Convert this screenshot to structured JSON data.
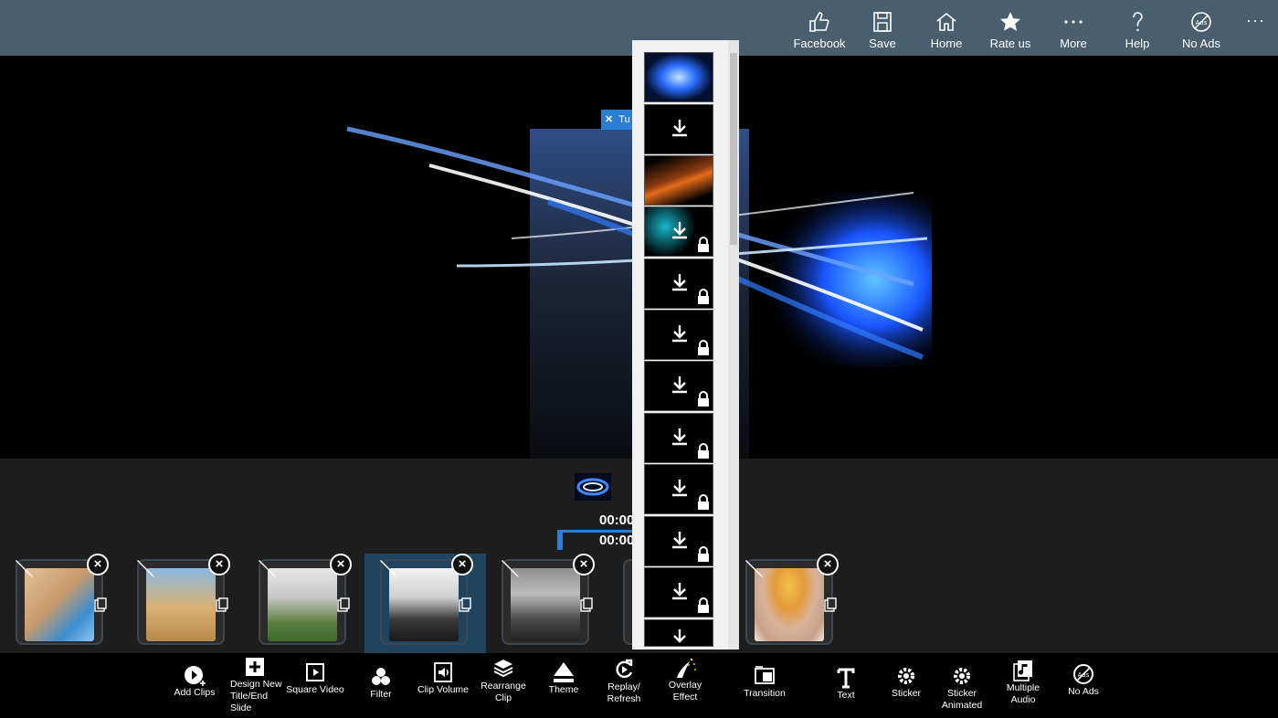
{
  "topbar": {
    "items": [
      {
        "label": "Facebook",
        "icon": "thumbs-up-icon"
      },
      {
        "label": "Save",
        "icon": "save-icon"
      },
      {
        "label": "Home",
        "icon": "home-icon"
      },
      {
        "label": "Rate us",
        "icon": "star-icon"
      },
      {
        "label": "More",
        "icon": "more-icon"
      },
      {
        "label": "Help",
        "icon": "help-icon"
      },
      {
        "label": "No Ads",
        "icon": "no-ads-icon"
      }
    ],
    "overflow": "···"
  },
  "preview": {
    "tag_text": "Tu",
    "tag_close": "✕"
  },
  "timeline": {
    "time1": "00:00",
    "time2": "00:00"
  },
  "clips": [
    {
      "name": "clip-1",
      "colors": [
        "#d7b690",
        "#4d8ec9"
      ]
    },
    {
      "name": "clip-2",
      "colors": [
        "#d9b070",
        "#7aaed6"
      ]
    },
    {
      "name": "clip-3",
      "colors": [
        "#cfcfcf",
        "#3c6b2b"
      ]
    },
    {
      "name": "clip-4",
      "colors": [
        "#ededed",
        "#222222"
      ]
    },
    {
      "name": "clip-5",
      "colors": [
        "#9a9a9a",
        "#2a2a2a"
      ]
    },
    {
      "name": "clip-7",
      "colors": [
        "#e8b34a",
        "#c7a089"
      ]
    }
  ],
  "overlay_panel": {
    "items": [
      {
        "type": "preview",
        "locked": false
      },
      {
        "type": "download",
        "locked": false
      },
      {
        "type": "orange",
        "locked": false
      },
      {
        "type": "download",
        "locked": true
      },
      {
        "type": "download",
        "locked": true
      },
      {
        "type": "download",
        "locked": true
      },
      {
        "type": "download",
        "locked": true
      },
      {
        "type": "download",
        "locked": true
      },
      {
        "type": "download",
        "locked": true
      },
      {
        "type": "download",
        "locked": true
      },
      {
        "type": "download",
        "locked": true
      },
      {
        "type": "download",
        "locked": false
      }
    ]
  },
  "toolbar": {
    "items": [
      {
        "label": "Add Clips",
        "icon": "add-clips-icon"
      },
      {
        "label": "Design New Title/End Slide",
        "icon": "design-slide-icon"
      },
      {
        "label": "Square Video",
        "icon": "square-video-icon"
      },
      {
        "label": "Filter",
        "icon": "filter-icon"
      },
      {
        "label": "Clip Volume",
        "icon": "volume-icon"
      },
      {
        "label": "Rearrange Clip",
        "icon": "rearrange-icon"
      },
      {
        "label": "Theme",
        "icon": "theme-icon"
      },
      {
        "label": "Replay/ Refresh",
        "icon": "refresh-icon"
      },
      {
        "label": "Overlay Effect",
        "icon": "overlay-icon"
      },
      {
        "label": "Transition",
        "icon": "transition-icon"
      },
      {
        "label": "Text",
        "icon": "text-icon"
      },
      {
        "label": "Sticker",
        "icon": "sticker-icon"
      },
      {
        "label": "Sticker Animated",
        "icon": "sticker-animated-icon"
      },
      {
        "label": "Multiple Audio",
        "icon": "multiple-audio-icon"
      },
      {
        "label": "No Ads",
        "icon": "no-ads-icon"
      }
    ]
  }
}
